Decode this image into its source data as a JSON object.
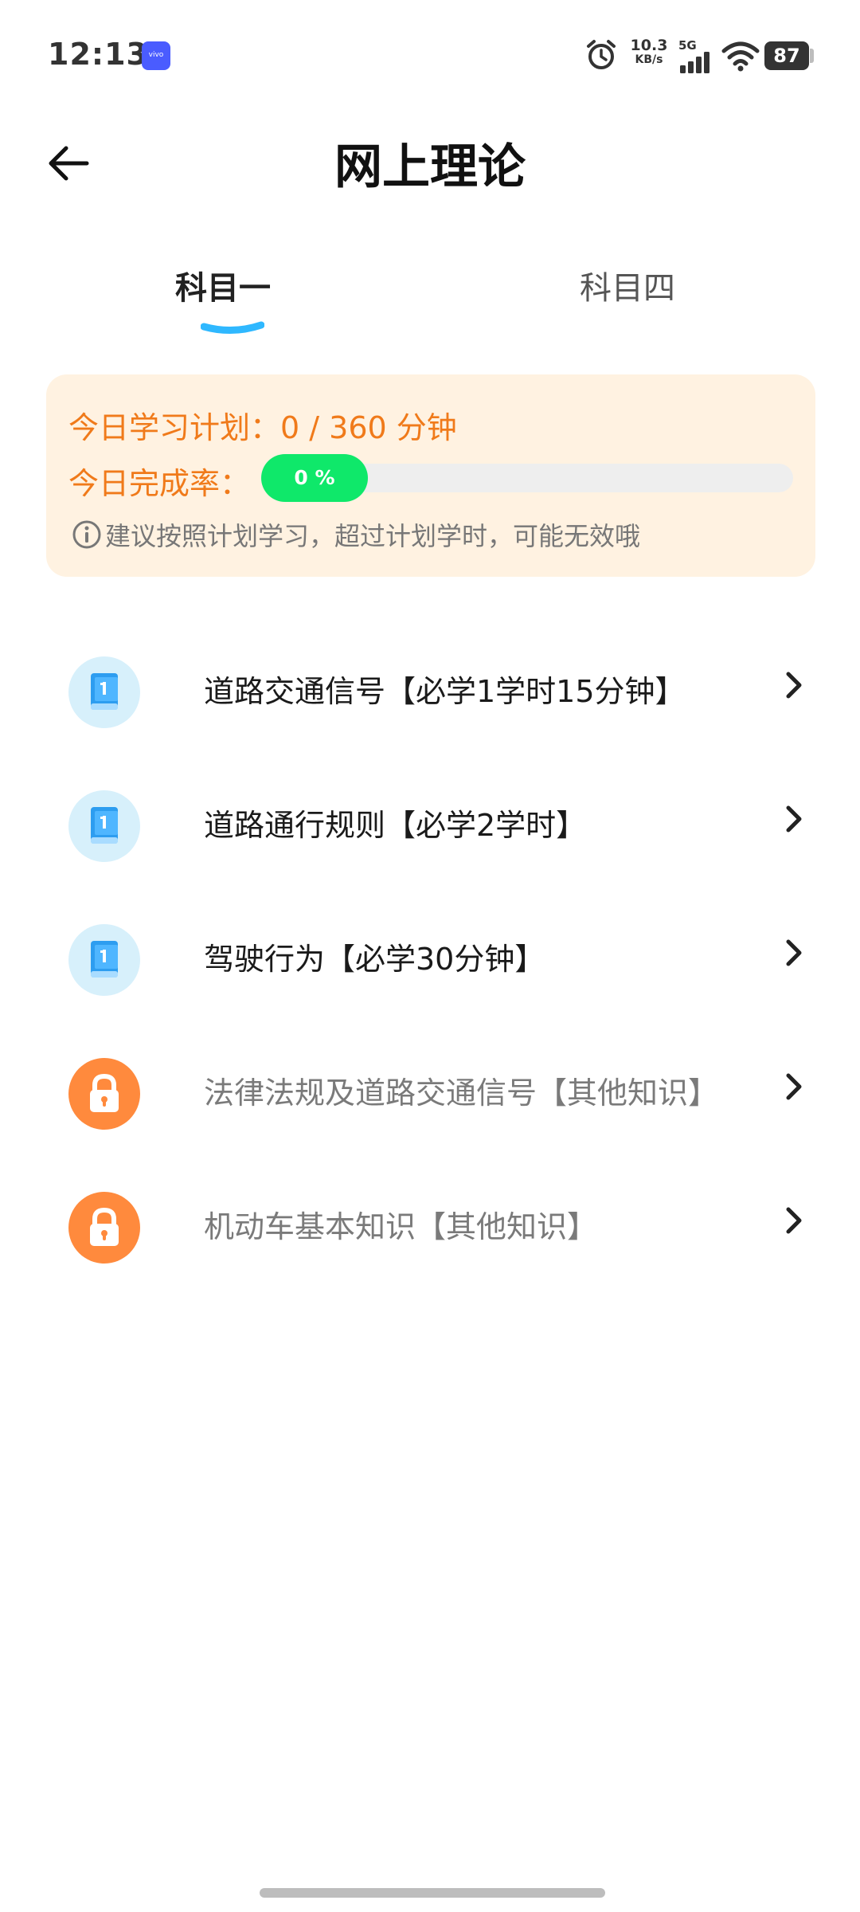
{
  "status_bar": {
    "time": "12:13",
    "vivo_badge": "vivo",
    "net_speed_value": "10.3",
    "net_speed_unit": "KB/s",
    "signal_label": "5G",
    "battery": "87"
  },
  "header": {
    "title": "网上理论"
  },
  "tabs": [
    {
      "label": "科目一",
      "selected": true
    },
    {
      "label": "科目四",
      "selected": false
    }
  ],
  "plan": {
    "plan_label": "今日学习计划：",
    "plan_value": "0 / 360 分钟",
    "rate_label": "今日完成率：",
    "progress_text": "0 %",
    "progress": 0,
    "tip": "建议按照计划学习，超过计划学时，可能无效哦"
  },
  "items": [
    {
      "label": "道路交通信号【必学1学时15分钟】",
      "icon": "book-icon",
      "locked": false
    },
    {
      "label": "道路通行规则【必学2学时】",
      "icon": "book-icon",
      "locked": false
    },
    {
      "label": "驾驶行为【必学30分钟】",
      "icon": "book-icon",
      "locked": false
    },
    {
      "label": "法律法规及道路交通信号【其他知识】",
      "icon": "lock-icon",
      "locked": true
    },
    {
      "label": "机动车基本知识【其他知识】",
      "icon": "lock-icon",
      "locked": true
    }
  ],
  "colors": {
    "accent_orange": "#f07a1a",
    "card_bg": "#fff2e1",
    "progress_green": "#0fe86a",
    "tab_indicator": "#2fb8ff"
  }
}
